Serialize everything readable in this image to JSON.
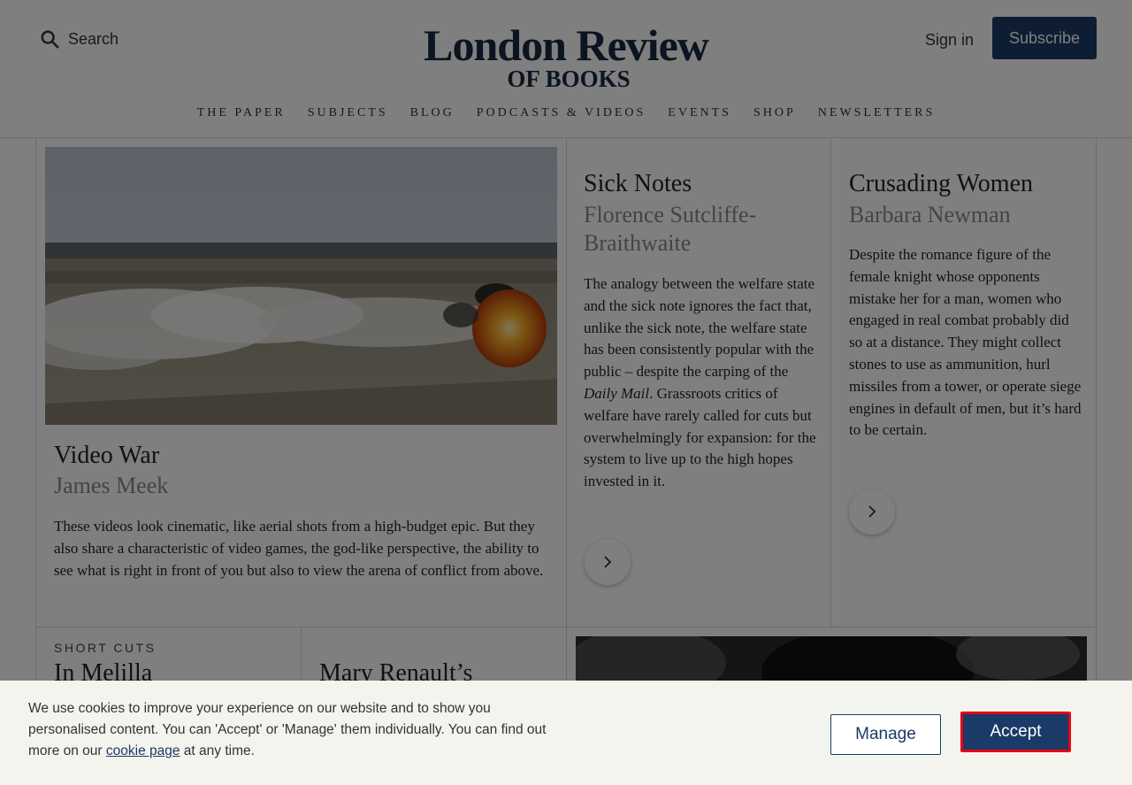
{
  "header": {
    "search_label": "Search",
    "logo_line1": "London Review",
    "logo_line2": "OF BOOKS",
    "signin_label": "Sign in",
    "subscribe_label": "Subscribe"
  },
  "nav": {
    "items": [
      "THE PAPER",
      "SUBJECTS",
      "BLOG",
      "PODCASTS & VIDEOS",
      "EVENTS",
      "SHOP",
      "NEWSLETTERS"
    ]
  },
  "articles": [
    {
      "title": "Video War",
      "author": "James Meek",
      "excerpt": "These videos look cinematic, like aerial shots from a high-budget epic. But they also share a characteristic of video games, the god-like perspective, the ability to see what is right in front of you but also to view the arena of conflict from above."
    },
    {
      "title": "Sick Notes",
      "author": "Florence Sutcliffe-Braithwaite",
      "excerpt_before": "The analogy between the welfare state and the sick note ignores the fact that, unlike the sick note, the welfare state has been consistently popular with the public – despite the carping of the ",
      "excerpt_italic": "Daily Mail",
      "excerpt_after": ". Grassroots critics of welfare have rarely called for cuts but overwhelmingly for expansion: for the system to live up to the high hopes invested in it."
    },
    {
      "title": "Crusading Women",
      "author": "Barbara Newman",
      "excerpt": "Despite the romance figure of the female knight whose opponents mistake her for a man, women who engaged in real combat probably did so at a distance. They might collect stones to use as ammunition, hurl missiles from a tower, or operate siege engines in default of men, but it’s hard to be certain."
    }
  ],
  "lower": {
    "kicker": "SHORT CUTS",
    "title1": "In Melilla",
    "title2": "Mary Renault’s"
  },
  "cookie": {
    "text_before": "We use cookies to improve your experience on our website and to show you personalised content. You can 'Accept' or 'Manage' them individually. You can find out more on our ",
    "link": "cookie page",
    "text_after": " at any time.",
    "manage_label": "Manage",
    "accept_label": "Accept"
  },
  "colors": {
    "brand": "#1b3a67",
    "highlight": "#e30613"
  }
}
